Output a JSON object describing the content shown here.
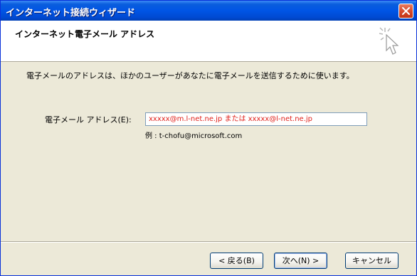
{
  "window": {
    "title": "インターネット接続ウィザード"
  },
  "header": {
    "title": "インターネット電子メール アドレス"
  },
  "main": {
    "description": "電子メールのアドレスは、ほかのユーザーがあなたに電子メールを送信するために使います。",
    "email_label": "電子メール アドレス(E):",
    "email_value": "xxxxx@m.l-net.ne.jp または xxxxx@l-net.ne.jp",
    "example": "例 : t-chofu@microsoft.com"
  },
  "buttons": {
    "back": "< 戻る(B)",
    "next": "次へ(N) >",
    "cancel": "キャンセル"
  },
  "colors": {
    "titlebar": "#0055e5",
    "input_text": "#e0201a",
    "dialog_background": "#ece9d8"
  },
  "icons": {
    "close": "close-icon",
    "wizard": "wizard-sparkle-cursor-icon"
  }
}
